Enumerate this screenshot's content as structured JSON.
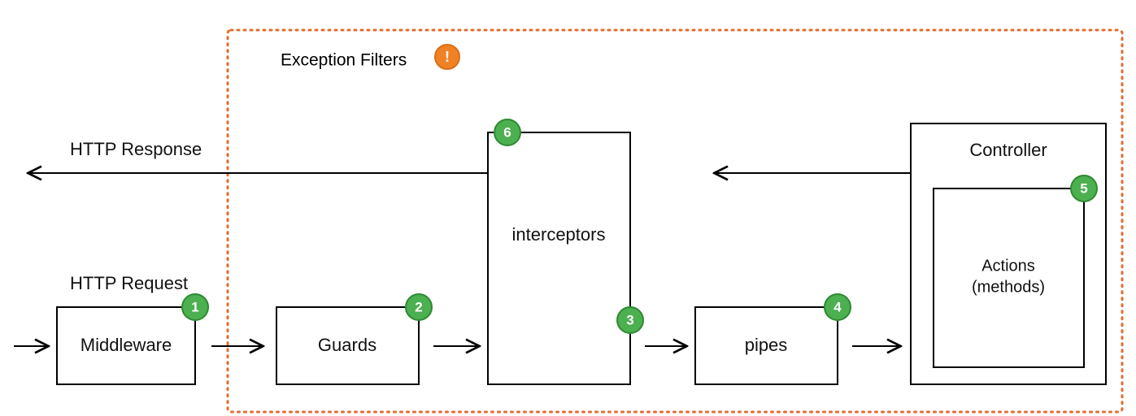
{
  "labels": {
    "exception_filters": "Exception Filters",
    "http_response": "HTTP Response",
    "http_request": "HTTP Request",
    "middleware": "Middleware",
    "guards": "Guards",
    "interceptors": "interceptors",
    "pipes": "pipes",
    "controller": "Controller",
    "actions_line1": "Actions",
    "actions_line2": "(methods)"
  },
  "badges": {
    "b1": "1",
    "b2": "2",
    "b3": "3",
    "b4": "4",
    "b5": "5",
    "b6": "6",
    "warn": "!"
  }
}
